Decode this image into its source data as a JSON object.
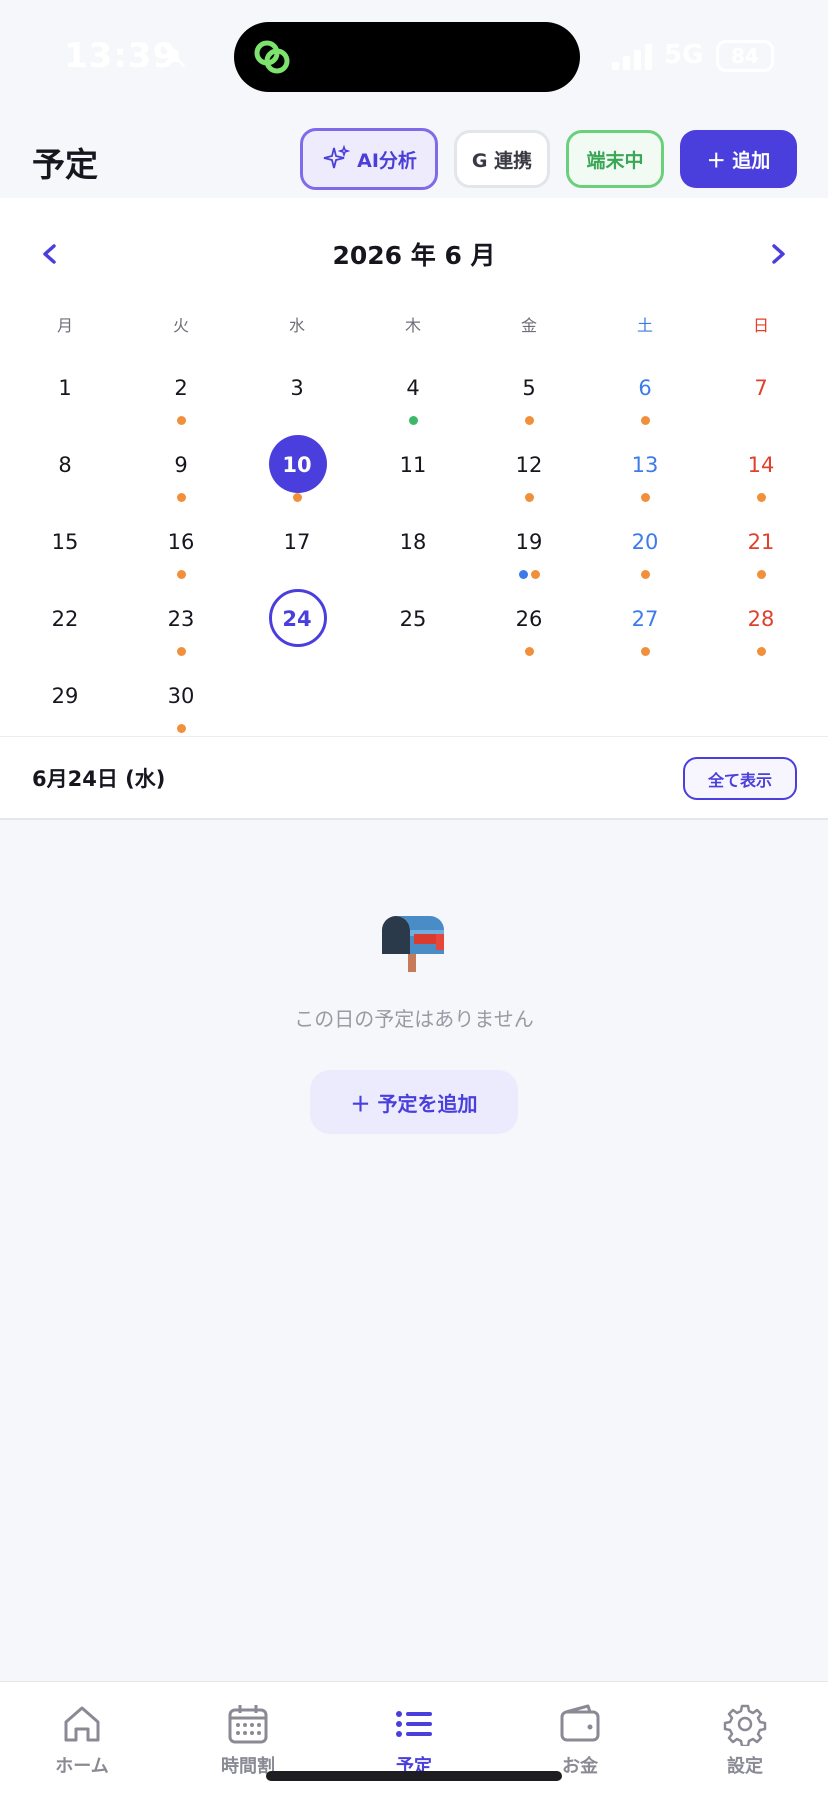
{
  "status_bar": {
    "time": "13:39",
    "network": "5G",
    "battery": "84"
  },
  "header": {
    "title": "予定",
    "ai_button": "AI分析",
    "google_button": "G 連携",
    "device_button": "端末中",
    "add_button": "＋ 追加"
  },
  "calendar": {
    "month_label": "2026 年 6 月",
    "weekdays": [
      "月",
      "火",
      "水",
      "木",
      "金",
      "土",
      "日"
    ],
    "today": 10,
    "selected": 24,
    "first_weekday_index": 0,
    "days_in_month": 30,
    "event_colors": {
      "orange": "#f0903a",
      "green": "#3fb768",
      "blue": "#3d7bea"
    },
    "events": {
      "2": [
        "orange"
      ],
      "4": [
        "green"
      ],
      "5": [
        "orange"
      ],
      "6": [
        "orange"
      ],
      "9": [
        "orange"
      ],
      "10": [
        "orange"
      ],
      "12": [
        "orange"
      ],
      "13": [
        "orange"
      ],
      "14": [
        "orange"
      ],
      "16": [
        "orange"
      ],
      "19": [
        "blue",
        "orange"
      ],
      "20": [
        "orange"
      ],
      "21": [
        "orange"
      ],
      "23": [
        "orange"
      ],
      "26": [
        "orange"
      ],
      "27": [
        "orange"
      ],
      "28": [
        "orange"
      ],
      "30": [
        "orange"
      ]
    }
  },
  "selected_day": {
    "label": "6月24日 (水)",
    "show_all": "全て表示",
    "empty_message": "この日の予定はありません",
    "add_plan": "＋ 予定を追加"
  },
  "tabs": [
    {
      "label": "ホーム",
      "icon": "home-icon",
      "active": false
    },
    {
      "label": "時間割",
      "icon": "calendar-grid-icon",
      "active": false
    },
    {
      "label": "予定",
      "icon": "list-icon",
      "active": true
    },
    {
      "label": "お金",
      "icon": "wallet-icon",
      "active": false
    },
    {
      "label": "設定",
      "icon": "gear-icon",
      "active": false
    }
  ],
  "colors": {
    "accent": "#4a3fdc",
    "saturday": "#3d7bea",
    "sunday": "#e0402c"
  }
}
